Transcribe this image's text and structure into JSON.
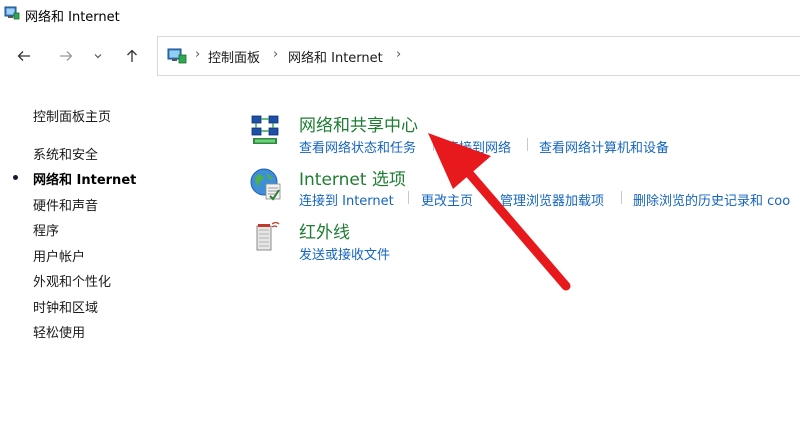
{
  "window": {
    "title": "网络和 Internet",
    "icon": "network-control-panel-icon"
  },
  "toolbar": {
    "back_icon": "back-arrow-icon",
    "forward_icon": "forward-arrow-icon",
    "recent_icon": "chevron-down-icon",
    "up_icon": "up-arrow-icon"
  },
  "address": {
    "icon": "control-panel-icon",
    "crumbs": [
      "控制面板",
      "网络和 Internet"
    ],
    "separator": "›"
  },
  "sidebar": {
    "items": [
      {
        "label": "控制面板主页",
        "active": false
      },
      {
        "label": "系统和安全",
        "active": false
      },
      {
        "label": "网络和 Internet",
        "active": true
      },
      {
        "label": "硬件和声音",
        "active": false
      },
      {
        "label": "程序",
        "active": false
      },
      {
        "label": "用户帐户",
        "active": false
      },
      {
        "label": "外观和个性化",
        "active": false
      },
      {
        "label": "时钟和区域",
        "active": false
      },
      {
        "label": "轻松使用",
        "active": false
      }
    ]
  },
  "categories": [
    {
      "title": "网络和共享中心",
      "icon": "network-sharing-center-icon",
      "links": [
        "查看网络状态和任务",
        "连接到网络",
        "查看网络计算机和设备"
      ]
    },
    {
      "title": "Internet 选项",
      "icon": "internet-options-globe-icon",
      "links": [
        "连接到 Internet",
        "更改主页",
        "管理浏览器加载项",
        "删除浏览的历史记录和 coo"
      ]
    },
    {
      "title": "红外线",
      "icon": "infrared-device-icon",
      "links": [
        "发送或接收文件"
      ]
    }
  ],
  "colors": {
    "category_title": "#1e7d32",
    "link": "#1565c0",
    "annotation_arrow": "#e8191c"
  },
  "annotation": {
    "icon": "red-pointer-arrow-icon"
  }
}
